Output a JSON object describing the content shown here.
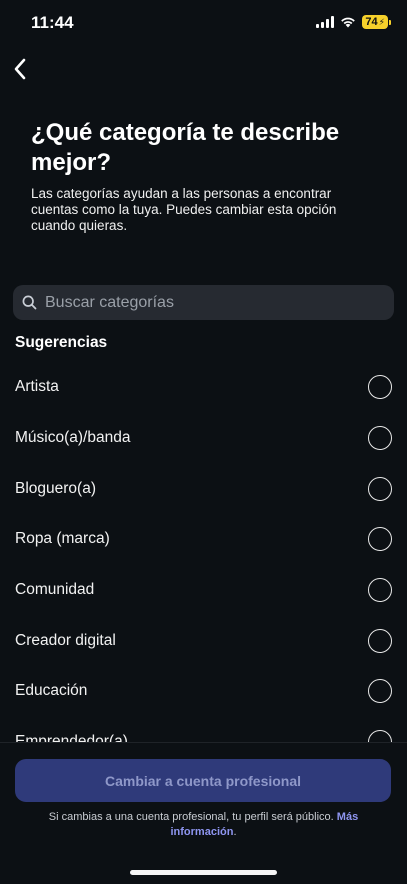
{
  "status_bar": {
    "time": "11:44",
    "battery": "74"
  },
  "header": {
    "title": "¿Qué categoría te describe mejor?",
    "description": "Las categorías ayudan a las personas a encontrar cuentas como la tuya. Puedes cambiar esta opción cuando quieras."
  },
  "search": {
    "placeholder": "Buscar categorías",
    "value": ""
  },
  "suggestions": {
    "title": "Sugerencias",
    "items": [
      {
        "label": "Artista",
        "selected": false
      },
      {
        "label": "Músico(a)/banda",
        "selected": false
      },
      {
        "label": "Bloguero(a)",
        "selected": false
      },
      {
        "label": "Ropa (marca)",
        "selected": false
      },
      {
        "label": "Comunidad",
        "selected": false
      },
      {
        "label": "Creador digital",
        "selected": false
      },
      {
        "label": "Educación",
        "selected": false
      },
      {
        "label": "Emprendedor(a)",
        "selected": false
      }
    ]
  },
  "footer": {
    "button_label": "Cambiar a cuenta profesional",
    "note_text": "Si cambias a una cuenta profesional, tu perfil será público.",
    "note_link": "Más información",
    "note_end": "."
  },
  "colors": {
    "background": "#0c1014",
    "button_bg": "#2f3a7a",
    "link": "#8e95f0",
    "battery": "#f7d12b"
  }
}
